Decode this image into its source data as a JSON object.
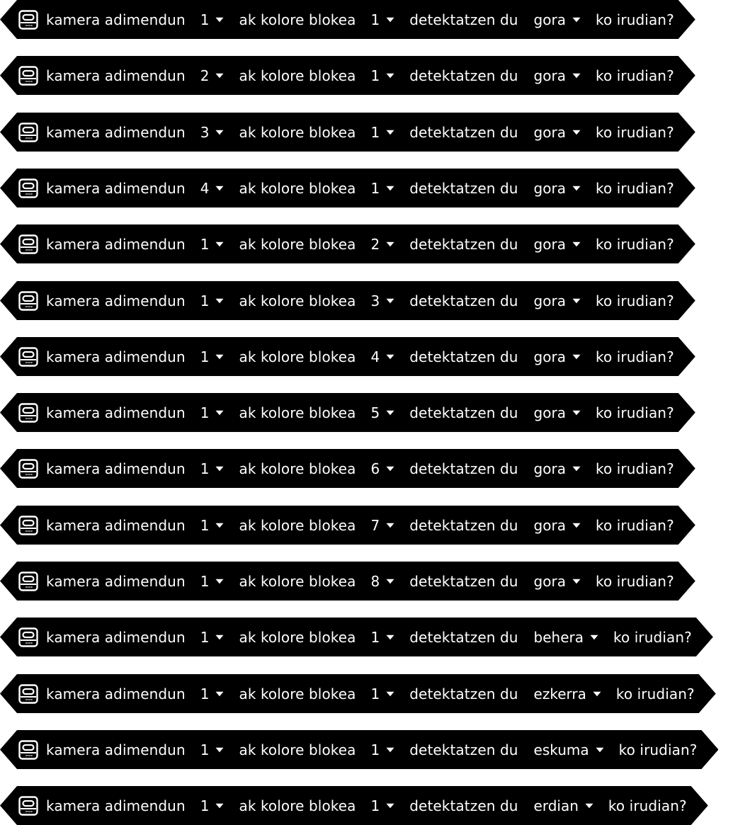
{
  "text": {
    "lead": "kamera adimendun",
    "mid": "ak kolore blokea",
    "detect": "detektatzen du",
    "tail": "ko irudian?"
  },
  "colors": {
    "block_fill": "#000000",
    "block_text": "#ffffff",
    "background": "#ffffff"
  },
  "icon": "smart-camera-icon",
  "blocks": [
    {
      "camera": "1",
      "color_block": "1",
      "direction": "gora"
    },
    {
      "camera": "2",
      "color_block": "1",
      "direction": "gora"
    },
    {
      "camera": "3",
      "color_block": "1",
      "direction": "gora"
    },
    {
      "camera": "4",
      "color_block": "1",
      "direction": "gora"
    },
    {
      "camera": "1",
      "color_block": "2",
      "direction": "gora"
    },
    {
      "camera": "1",
      "color_block": "3",
      "direction": "gora"
    },
    {
      "camera": "1",
      "color_block": "4",
      "direction": "gora"
    },
    {
      "camera": "1",
      "color_block": "5",
      "direction": "gora"
    },
    {
      "camera": "1",
      "color_block": "6",
      "direction": "gora"
    },
    {
      "camera": "1",
      "color_block": "7",
      "direction": "gora"
    },
    {
      "camera": "1",
      "color_block": "8",
      "direction": "gora"
    },
    {
      "camera": "1",
      "color_block": "1",
      "direction": "behera"
    },
    {
      "camera": "1",
      "color_block": "1",
      "direction": "ezkerra"
    },
    {
      "camera": "1",
      "color_block": "1",
      "direction": "eskuma"
    },
    {
      "camera": "1",
      "color_block": "1",
      "direction": "erdian"
    }
  ]
}
